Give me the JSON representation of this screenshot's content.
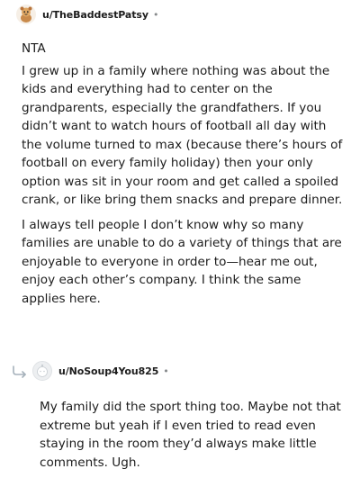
{
  "comments": [
    {
      "username": "u/TheBaddestPatsy",
      "separator": "•",
      "avatar_icon": "snoo-avatar-icon",
      "paragraphs": [
        "NTA",
        "I grew up in a family where nothing was about the kids and everything had to center on the grandparents, especially the grandfathers. If you didn’t want to watch hours of football all day with the volume turned to max (because there’s hours of football on every family holiday) then your only option was sit in your room and get called a spoiled crank, or like bring them snacks and prepare dinner.",
        "I always tell people I don’t know why so many families are unable to do a variety of things that are enjoyable to everyone in order to—hear me out, enjoy each other’s company. I think the same applies here."
      ]
    },
    {
      "username": "u/NoSoup4You825",
      "separator": "•",
      "avatar_icon": "default-avatar-icon",
      "reply_icon": "reply-arrow-icon",
      "paragraphs": [
        "My family did the sport thing too. Maybe not that extreme but yeah if I even tried to read even staying in the room they’d always make little comments. Ugh."
      ]
    }
  ],
  "colors": {
    "text": "#1c1c1c",
    "meta": "#878a8c",
    "avatar_orange": "#d98a3d",
    "avatar_grey": "#edeff1"
  }
}
